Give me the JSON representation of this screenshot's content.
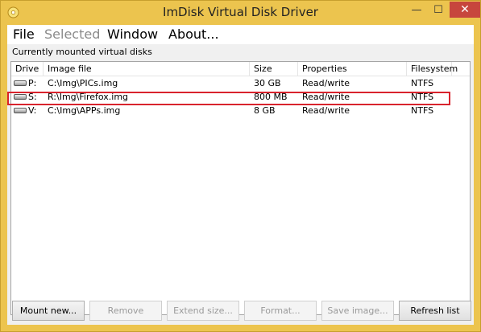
{
  "window": {
    "title": "ImDisk Virtual Disk Driver",
    "minimize_glyph": "—",
    "maximize_glyph": "☐",
    "close_glyph": "✕",
    "icon": "imdisk-app-icon",
    "accent_color": "#ecc44e",
    "close_color": "#c7463d"
  },
  "menu": {
    "items": [
      {
        "label": "File",
        "enabled": true
      },
      {
        "label": "Selected",
        "enabled": false
      },
      {
        "label": "Window",
        "enabled": true
      },
      {
        "label": "About...",
        "enabled": true
      }
    ]
  },
  "group": {
    "label": "Currently mounted virtual disks"
  },
  "list": {
    "columns": [
      "Drive",
      "Image file",
      "Size",
      "Properties",
      "Filesystem"
    ],
    "rows": [
      {
        "drive": "P:",
        "image": "C:\\Img\\PICs.img",
        "size": "30 GB",
        "properties": "Read/write",
        "filesystem": "NTFS",
        "icon": "hard-drive-icon"
      },
      {
        "drive": "S:",
        "image": "R:\\Img\\Firefox.img",
        "size": "800 MB",
        "properties": "Read/write",
        "filesystem": "NTFS",
        "icon": "hard-drive-icon",
        "highlighted": true
      },
      {
        "drive": "V:",
        "image": "C:\\Img\\APPs.img",
        "size": "8 GB",
        "properties": "Read/write",
        "filesystem": "NTFS",
        "icon": "hard-drive-icon"
      }
    ],
    "highlight_color": "#d9232d"
  },
  "buttons": {
    "mount": "Mount new...",
    "remove": "Remove",
    "extend": "Extend size...",
    "format": "Format...",
    "save": "Save image...",
    "refresh": "Refresh list"
  }
}
